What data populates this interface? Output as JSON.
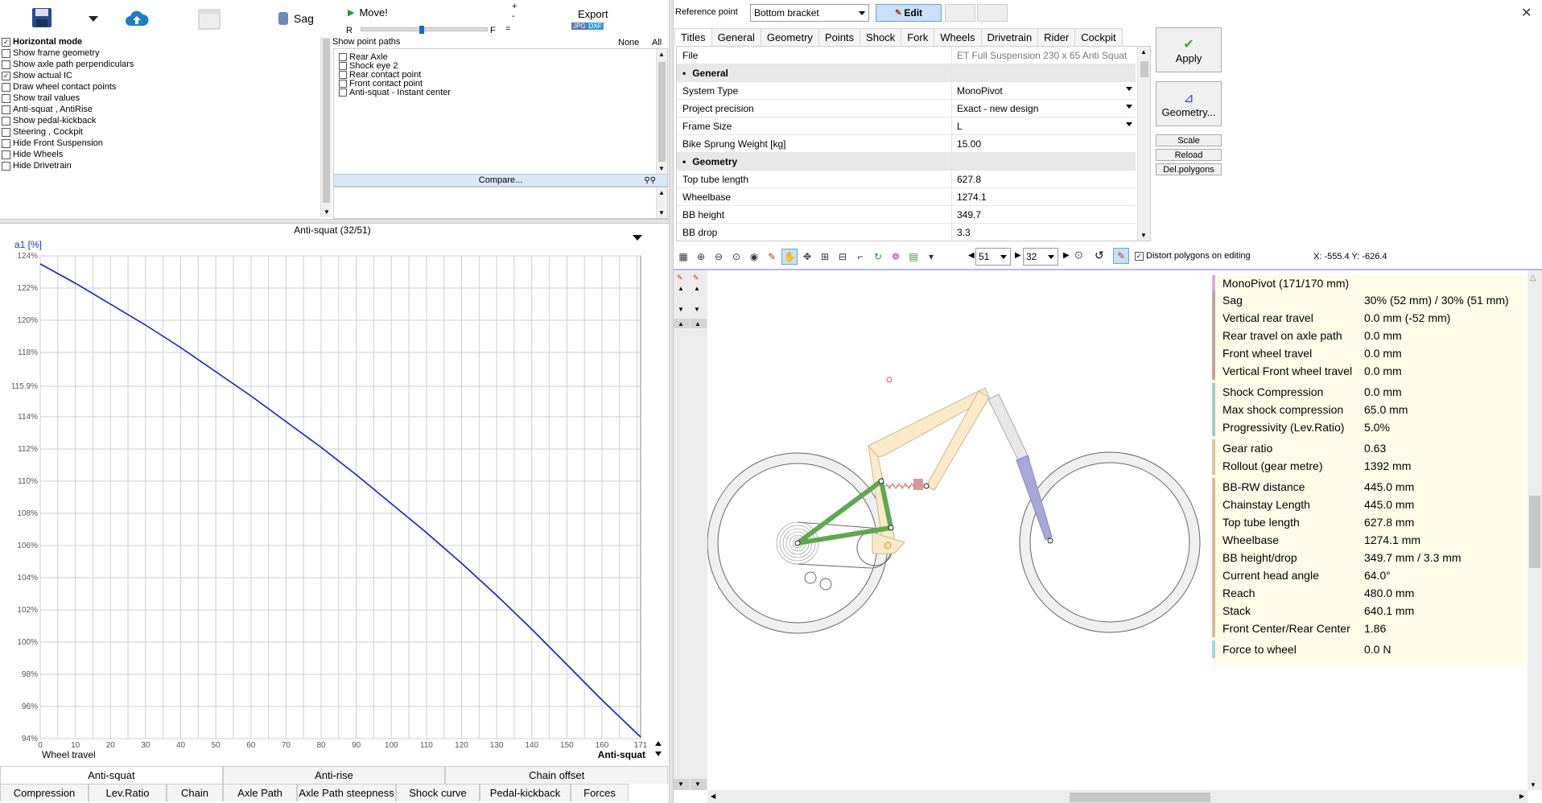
{
  "toolbar": {
    "sag": "Sag",
    "move": "Move!",
    "export": "Export",
    "r": "R",
    "f": "F",
    "plus": "+",
    "minus": "-",
    "eq": "=",
    "jpg": "JPG",
    "dxf": "DXF"
  },
  "options": [
    {
      "label": "Horizontal mode",
      "checked": true,
      "bold": true
    },
    {
      "label": "Show frame geometry",
      "checked": false
    },
    {
      "label": "Show axle path perpendiculars",
      "checked": false
    },
    {
      "label": "Show actual IC",
      "checked": true
    },
    {
      "label": "Draw wheel contact points",
      "checked": false
    },
    {
      "label": "Show trail values",
      "checked": false
    },
    {
      "label": "Anti-squat , AntiRise",
      "checked": false
    },
    {
      "label": "Show pedal-kickback",
      "checked": false
    },
    {
      "label": "Steering ,  Cockpit",
      "checked": false
    },
    {
      "label": "Hide Front Suspension",
      "checked": false
    },
    {
      "label": "Hide Wheels",
      "checked": false
    },
    {
      "label": "Hide Drivetrain",
      "checked": false
    }
  ],
  "paths": {
    "title": "Show point paths",
    "none": "None",
    "all": "All",
    "items": [
      "Rear Axle",
      "Shock eye 2",
      "Rear contact point",
      "Front contact point",
      "Anti-squat - Instant center"
    ],
    "compare": "Compare..."
  },
  "chart_data": {
    "type": "line",
    "title": "Anti-squat (32/51)",
    "ylabel": "a1 [%]",
    "xlabel": "Wheel travel",
    "xlabel_right": "Anti-squat",
    "xlim": [
      0,
      171
    ],
    "ylim": [
      94,
      124
    ],
    "x_ticks": [
      0,
      10,
      20,
      30,
      40,
      50,
      60,
      70,
      80,
      90,
      100,
      110,
      120,
      130,
      140,
      150,
      160,
      171
    ],
    "y_ticks": [
      "94%",
      "96%",
      "98%",
      "100%",
      "102%",
      "104%",
      "106%",
      "108%",
      "110%",
      "112%",
      "114%",
      "115.9%",
      "118%",
      "120%",
      "122%",
      "124%"
    ],
    "x": [
      0,
      10,
      20,
      30,
      40,
      50,
      60,
      70,
      80,
      90,
      100,
      110,
      120,
      130,
      140,
      150,
      160,
      171
    ],
    "y": [
      123.5,
      122.3,
      121.0,
      119.7,
      118.3,
      116.8,
      115.3,
      113.7,
      112.1,
      110.4,
      108.6,
      106.8,
      104.9,
      102.9,
      100.8,
      98.6,
      96.4,
      94.1
    ],
    "color": "#1020cc",
    "grid": true
  },
  "bottom_tabs_top": [
    {
      "label": "Anti-squat",
      "active": true
    },
    {
      "label": "Anti-rise"
    },
    {
      "label": "Chain offset"
    }
  ],
  "bottom_tabs": [
    "Compression",
    "Lev.Ratio",
    "Chain",
    "Axle Path",
    "Axle Path steepness",
    "Shock curve",
    "Pedal-kickback",
    "Forces"
  ],
  "reference": {
    "label": "Reference point",
    "value": "Bottom bracket",
    "edit": "Edit"
  },
  "prop_tabs": [
    "Titles",
    "General",
    "Geometry",
    "Points",
    "Shock",
    "Fork",
    "Wheels",
    "Drivetrain",
    "Rider",
    "Cockpit"
  ],
  "grid_rows": [
    {
      "k": "File",
      "v": "ET Full Suspension 230 x 65 Anti Squat"
    },
    {
      "k": "General",
      "sec": true
    },
    {
      "k": "System Type",
      "v": "MonoPivot",
      "dd": true
    },
    {
      "k": "Project precision",
      "v": "Exact - new design",
      "dd": true
    },
    {
      "k": "Frame Size",
      "v": "L",
      "dd": true
    },
    {
      "k": "Bike Sprung Weight [kg]",
      "v": "15.00"
    },
    {
      "k": "Geometry",
      "sec": true
    },
    {
      "k": "Top tube length",
      "v": "627.8"
    },
    {
      "k": "Wheelbase",
      "v": "1274.1"
    },
    {
      "k": "BB height",
      "v": "349.7"
    },
    {
      "k": "BB drop",
      "v": "3.3"
    }
  ],
  "buttons": {
    "apply": "Apply",
    "geometry": "Geometry...",
    "scale": "Scale",
    "reload": "Reload",
    "del": "Del.polygons"
  },
  "viewbar": {
    "front": "51",
    "rear": "32",
    "distort": "Distort polygons on editing",
    "coord": "X: -555.4  Y: -626.4"
  },
  "info": {
    "title": "MonoPivot (171/170 mm)",
    "rows": [
      {
        "k": "Sag",
        "v": "30% (52 mm) / 30% (51 mm)",
        "c": "#c9a0a0"
      },
      {
        "k": "Vertical rear travel",
        "v": "0.0 mm (-52 mm)",
        "c": "#c9a0a0"
      },
      {
        "k": "Rear travel on axle path",
        "v": "0.0 mm",
        "c": "#c9a0a0"
      },
      {
        "k": "Front wheel travel",
        "v": "0.0 mm",
        "c": "#c9a0a0"
      },
      {
        "k": "Vertical Front wheel travel",
        "v": "0.0 mm",
        "c": "#c9a0a0"
      },
      {
        "k": "Shock Compression",
        "v": "0.0 mm",
        "c": "#a8c8c0",
        "gap": true
      },
      {
        "k": "Max shock compression",
        "v": "65.0 mm",
        "c": "#a8c8c0"
      },
      {
        "k": "Progressivity (Lev.Ratio)",
        "v": "5.0%",
        "c": "#a8c8c0"
      },
      {
        "k": "Gear ratio",
        "v": "0.63",
        "c": "#d8c898",
        "gap": true
      },
      {
        "k": "Rollout (gear metre)",
        "v": "1392 mm",
        "c": "#d8c898"
      },
      {
        "k": "BB-RW distance",
        "v": "445.0 mm",
        "c": "#e0b890",
        "gap": true
      },
      {
        "k": "Chainstay Length",
        "v": "445.0 mm",
        "c": "#e0b890"
      },
      {
        "k": "Top tube length",
        "v": "627.8 mm",
        "c": "#e0b890"
      },
      {
        "k": "Wheelbase",
        "v": "1274.1 mm",
        "c": "#e0b890"
      },
      {
        "k": "BB height/drop",
        "v": "349.7 mm / 3.3 mm",
        "c": "#e0b890"
      },
      {
        "k": "Current head angle",
        "v": "64.0°",
        "c": "#e0b890"
      },
      {
        "k": "Reach",
        "v": "480.0 mm",
        "c": "#e0b890"
      },
      {
        "k": "Stack",
        "v": "640.1 mm",
        "c": "#e0b890"
      },
      {
        "k": "Front Center/Rear Center",
        "v": "1.86",
        "c": "#e0b890"
      },
      {
        "k": "Force to wheel",
        "v": "0.0 N",
        "c": "#a0d8d8",
        "gap": true
      }
    ]
  }
}
